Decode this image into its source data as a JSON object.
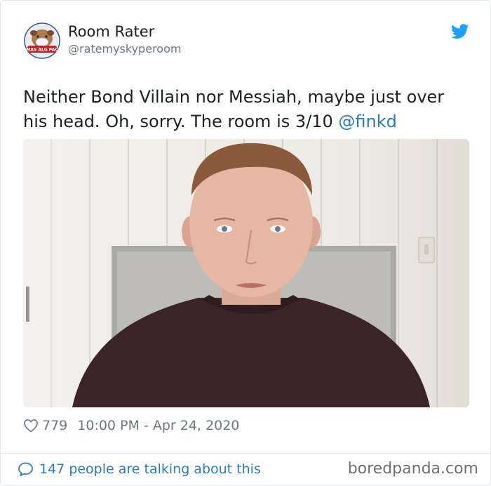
{
  "tweet": {
    "author_name": "Room Rater",
    "author_handle": "@ratemyskyperoom",
    "avatar_icon": "bulldog-mask-avatar",
    "text": "Neither Bond Villain nor Messiah, maybe just over his head. Oh, sorry. The room is 3/10 ",
    "mention": "@finkd",
    "image_alt": "Man in a dark sweater sitting in front of a white paneled wall with a gray board",
    "likes": "779",
    "timestamp": "10:00 PM - Apr 24, 2020",
    "talking": "147 people are talking about this"
  },
  "footer": {
    "watermark": "boredpanda.com"
  },
  "colors": {
    "link": "#2b7bb9",
    "twitter_blue": "#1da1f2",
    "muted": "#697882",
    "border": "#e1e8ed"
  }
}
